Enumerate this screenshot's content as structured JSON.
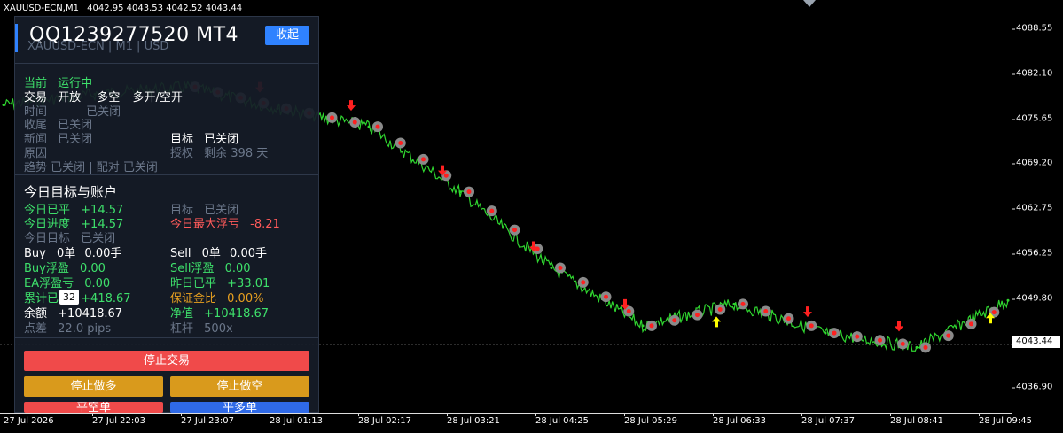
{
  "header": {
    "symbol": "XAUUSD-ECN,M1",
    "ohlc": "4042.95 4043.53 4042.52 4043.44"
  },
  "yaxis": {
    "ticks": [
      "4088.55",
      "4082.10",
      "4075.65",
      "4069.20",
      "4062.75",
      "4056.25",
      "4049.80",
      "4036.90"
    ],
    "current_price": "4043.44"
  },
  "xaxis": {
    "ticks": [
      "27 Jul 2026",
      "27 Jul 22:03",
      "27 Jul 23:07",
      "28 Jul 01:13",
      "28 Jul 02:17",
      "28 Jul 03:21",
      "28 Jul 04:25",
      "28 Jul 05:29",
      "28 Jul 06:33",
      "28 Jul 07:37",
      "28 Jul 08:41",
      "28 Jul 09:45"
    ]
  },
  "panel": {
    "account": "QQ1239277520 MT4",
    "close_label": "收起",
    "sub": "XAUUSD-ECN  |  M1  |  USD",
    "status": {
      "k": "当前",
      "v": "运行中"
    },
    "trade": {
      "k": "交易",
      "a": "开放",
      "b": "多空",
      "c": "多开/空开"
    },
    "time": {
      "k": "时间",
      "v": "已关闭"
    },
    "tail": {
      "k": "收尾",
      "v": "已关闭"
    },
    "news": {
      "k": "新闻",
      "v": "已关闭"
    },
    "reason": {
      "k": "原因",
      "v": ""
    },
    "trend": "趋势  已关闭  |  配对  已关闭",
    "target_top": {
      "k": "目标",
      "v": "已关闭"
    },
    "license": {
      "k": "授权",
      "v": "剩余 398 天"
    },
    "section_title": "今日目标与账户",
    "today_closed": {
      "k": "今日已平",
      "v": "+14.57"
    },
    "today_progress": {
      "k": "今日进度",
      "v": "+14.57"
    },
    "today_target": {
      "k": "今日目标",
      "v": "已关闭"
    },
    "target2": {
      "k": "目标",
      "v": "已关闭"
    },
    "max_float": {
      "k": "今日最大浮亏",
      "v": "-8.21"
    },
    "buy": {
      "k": "Buy",
      "n": "0单",
      "lots": "0.00手"
    },
    "sell": {
      "k": "Sell",
      "n": "0单",
      "lots": "0.00手"
    },
    "buy_float": {
      "k": "Buy浮盈",
      "v": "0.00"
    },
    "sell_float": {
      "k": "Sell浮盈",
      "v": "0.00"
    },
    "ea_float": {
      "k": "EA浮盈亏",
      "v": "0.00"
    },
    "yesterday": {
      "k": "昨日已平",
      "v": "+33.01"
    },
    "cumulative": {
      "k": "累计已平",
      "v": "+418.67"
    },
    "margin": {
      "k": "保证金比",
      "v": "0.00%"
    },
    "balance": {
      "k": "余额",
      "v": "+10418.67"
    },
    "equity": {
      "k": "净值",
      "v": "+10418.67"
    },
    "spread": {
      "k": "点差",
      "v": "22.0 pips"
    },
    "leverage": {
      "k": "杠杆",
      "v": "500x"
    },
    "tooltip": "32",
    "buttons": {
      "stop_trade": "停止交易",
      "stop_long": "停止做多",
      "stop_short": "停止做空",
      "close_short": "平空单",
      "close_long": "平多单"
    }
  },
  "colors": {
    "candle": "#2fd52f",
    "buy_arrow": "#ffff00",
    "sell_arrow": "#ff2020",
    "panel_bg": "#161c28",
    "accent": "#2f82ff",
    "red_btn": "#f04a4a",
    "gold_btn": "#d99a1c"
  },
  "chart_data": {
    "type": "line",
    "x": [
      "27 Jul 2026",
      "27 Jul 22:03",
      "27 Jul 23:07",
      "28 Jul 01:13",
      "28 Jul 02:17",
      "28 Jul 03:21",
      "28 Jul 04:25",
      "28 Jul 05:29",
      "28 Jul 06:33",
      "28 Jul 07:37",
      "28 Jul 08:41",
      "28 Jul 09:45"
    ],
    "series": [
      {
        "values": [
          4076.5,
          4078.0,
          4079.0,
          4076.0,
          4073.5,
          4064.5,
          4054.0,
          4046.0,
          4049.0,
          4045.0,
          4043.0,
          4049.5
        ]
      }
    ],
    "ylim": [
      4034.0,
      4091.0
    ],
    "grid": false
  }
}
